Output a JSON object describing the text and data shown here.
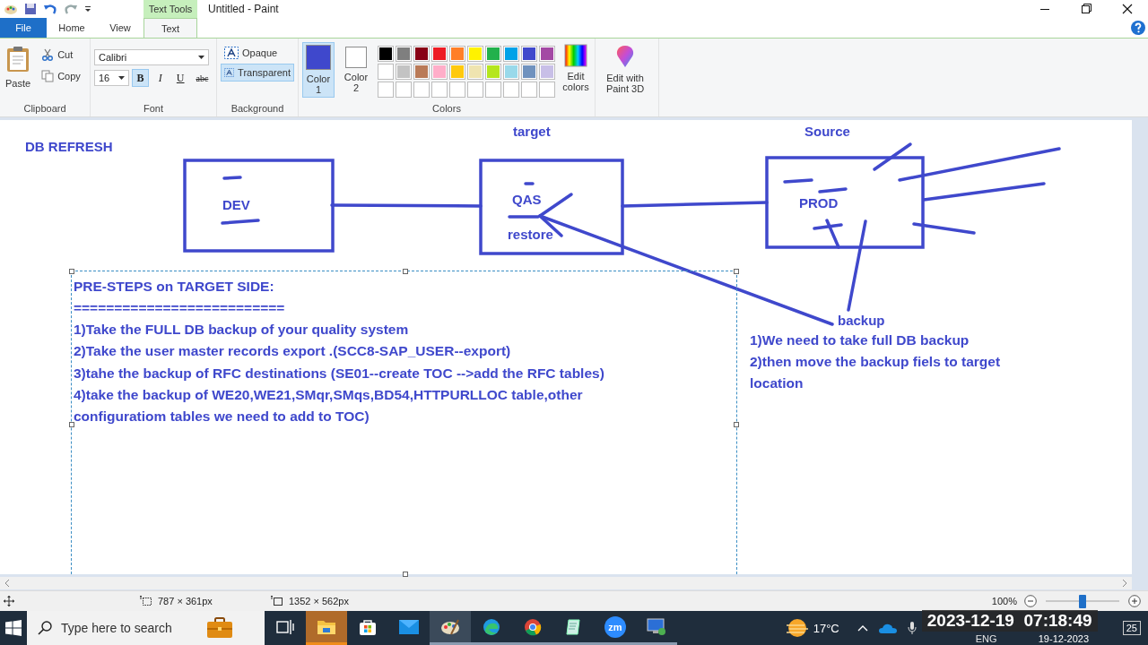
{
  "window": {
    "title": "Untitled - Paint",
    "context_tab": "Text Tools"
  },
  "tabs": [
    {
      "label": "File",
      "kind": "file",
      "selected": false
    },
    {
      "label": "Home",
      "kind": "tab",
      "selected": false
    },
    {
      "label": "View",
      "kind": "tab",
      "selected": false
    },
    {
      "label": "Text",
      "kind": "tab",
      "selected": true
    }
  ],
  "ribbon": {
    "clipboard": {
      "paste": "Paste",
      "cut": "Cut",
      "copy": "Copy",
      "label": "Clipboard"
    },
    "font": {
      "family": "Calibri",
      "size": "16",
      "label": "Font",
      "styles": [
        {
          "label": "B",
          "kind": "bold",
          "selected": true
        },
        {
          "label": "I",
          "kind": "italic",
          "selected": false
        },
        {
          "label": "U",
          "kind": "underline",
          "selected": false
        },
        {
          "label": "abc",
          "kind": "strike",
          "selected": false
        }
      ]
    },
    "background": {
      "label": "Background",
      "options": [
        {
          "label": "Opaque",
          "selected": false
        },
        {
          "label": "Transparent",
          "selected": true
        }
      ]
    },
    "colors": {
      "label": "Colors",
      "edit": "Edit colors",
      "slots": [
        {
          "label": "Color 1",
          "color": "#3f48cc",
          "selected": true
        },
        {
          "label": "Color 2",
          "color": "#ffffff",
          "selected": false
        }
      ],
      "palette": [
        [
          {
            "color": "#000000"
          },
          {
            "color": "#7f7f7f"
          },
          {
            "color": "#880015"
          },
          {
            "color": "#ed1c24"
          },
          {
            "color": "#ff7f27"
          },
          {
            "color": "#fff200"
          },
          {
            "color": "#22b14c"
          },
          {
            "color": "#00a2e8"
          },
          {
            "color": "#3f48cc"
          },
          {
            "color": "#a349a4"
          }
        ],
        [
          {
            "color": "#ffffff"
          },
          {
            "color": "#c3c3c3"
          },
          {
            "color": "#b97a57"
          },
          {
            "color": "#ffaec9"
          },
          {
            "color": "#ffc90e"
          },
          {
            "color": "#efe4b0"
          },
          {
            "color": "#b5e61d"
          },
          {
            "color": "#99d9ea"
          },
          {
            "color": "#7092be"
          },
          {
            "color": "#c8bfe7"
          }
        ]
      ]
    },
    "paint3d": "Edit with Paint 3D"
  },
  "canvas": {
    "heading": "DB REFRESH",
    "captions": [
      "target",
      "Source"
    ],
    "nodes": [
      {
        "label": "DEV"
      },
      {
        "label": "QAS",
        "note": "restore"
      },
      {
        "label": "PROD"
      }
    ],
    "text_box": {
      "lines": [
        "PRE-STEPS on TARGET SIDE:",
        "==========================",
        "1)Take the FULL DB backup of your quality system",
        "2)Take the user master records export .(SCC8-SAP_USER--export)",
        "3)tahe the backup of RFC destinations (SE01--create TOC -->add the RFC tables)",
        "4)take the backup of WE20,WE21,SMqr,SMqs,BD54,HTTPURLLOC table,other",
        "configuratiom tables we need to add to TOC)"
      ]
    },
    "backup": {
      "label": "backup",
      "lines": [
        "1)We need to take full DB backup",
        "2)then move the backup fiels to target",
        "location"
      ]
    }
  },
  "status_bar": {
    "selection": "787 × 361px",
    "canvas_size": "1352 × 562px",
    "zoom": "100%",
    "zoom_slider": {
      "level": 0.5
    }
  },
  "taskbar": {
    "search_placeholder": "Type here to search",
    "apps": [
      {
        "kind": "taskview",
        "running": false,
        "selected": false
      },
      {
        "kind": "explorer",
        "running": true,
        "selected": false
      },
      {
        "kind": "store",
        "running": false,
        "selected": false
      },
      {
        "kind": "mail",
        "running": false,
        "selected": false
      },
      {
        "kind": "paint",
        "running": true,
        "selected": true
      },
      {
        "kind": "edge",
        "running": true,
        "selected": false
      },
      {
        "kind": "chrome",
        "running": true,
        "selected": false
      },
      {
        "kind": "notes",
        "running": true,
        "selected": false
      },
      {
        "kind": "zoom",
        "label": "zm",
        "running": true,
        "selected": false
      },
      {
        "kind": "remote",
        "running": true,
        "selected": false
      }
    ],
    "weather": "17°C",
    "language": "ENG",
    "date": "19-12-2023",
    "notifications": "25"
  },
  "overlay": {
    "timestamp": "2023-12-19  07:18:49"
  }
}
